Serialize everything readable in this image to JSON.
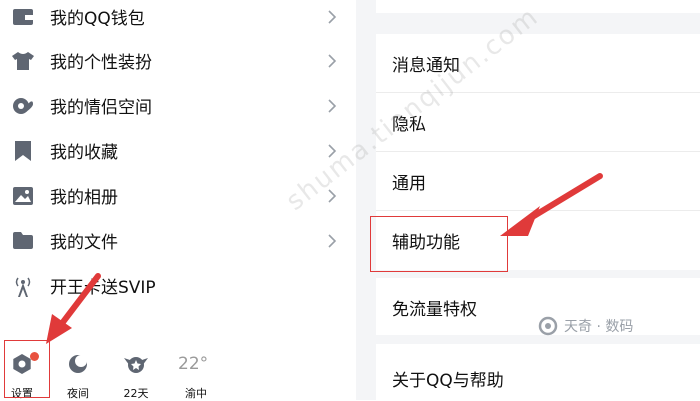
{
  "left_menu": {
    "items": [
      {
        "label": "我的QQ钱包",
        "icon": "wallet-icon"
      },
      {
        "label": "我的个性装扮",
        "icon": "shirt-icon"
      },
      {
        "label": "我的情侣空间",
        "icon": "couple-hearts-icon"
      },
      {
        "label": "我的收藏",
        "icon": "bookmark-icon"
      },
      {
        "label": "我的相册",
        "icon": "photo-icon"
      },
      {
        "label": "我的文件",
        "icon": "folder-icon"
      },
      {
        "label": "开王卡送SVIP",
        "icon": "signal-tower-icon"
      }
    ]
  },
  "bottom_bar": {
    "settings_label": "设置",
    "night_label": "夜间",
    "streak_label": "22天",
    "weather_label": "渝中",
    "temperature": "22°"
  },
  "settings_list": {
    "items": [
      {
        "label": "消息通知"
      },
      {
        "label": "隐私"
      },
      {
        "label": "通用"
      },
      {
        "label": "辅助功能"
      },
      {
        "label": "免流量特权"
      },
      {
        "label": "关于QQ与帮助"
      }
    ]
  },
  "overlay": {
    "watermark": "shuma.tianqijun.com",
    "brand": "天奇 · 数码"
  },
  "colors": {
    "highlight": "#e03a3a",
    "badge": "#e8523f",
    "icon": "#5f6672",
    "page_bg": "#f4f5f7"
  }
}
